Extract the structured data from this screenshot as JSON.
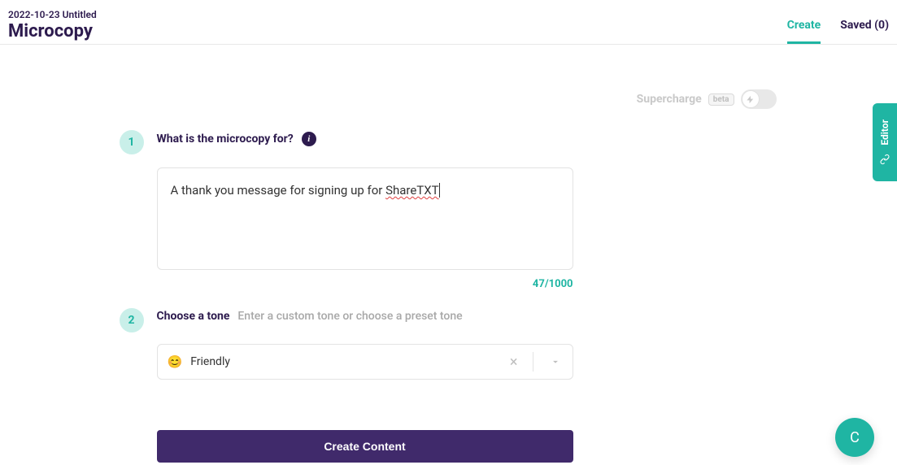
{
  "header": {
    "doc_date": "2022-10-23 Untitled",
    "doc_title": "Microcopy",
    "tabs": {
      "create": "Create",
      "saved": "Saved (0)"
    }
  },
  "supercharge": {
    "label": "Supercharge",
    "badge": "beta"
  },
  "step1": {
    "number": "1",
    "title": "What is the microcopy for?",
    "info": "i",
    "text_prefix": "A thank you message for signing up for ",
    "text_spell": "ShareTXT",
    "char_count": "47/1000"
  },
  "step2": {
    "number": "2",
    "title": "Choose a tone",
    "hint": "Enter a custom tone or choose a preset tone",
    "select_emoji": "😊",
    "select_value": "Friendly"
  },
  "create_button": "Create Content",
  "editor_tab": "Editor",
  "fab": "C"
}
